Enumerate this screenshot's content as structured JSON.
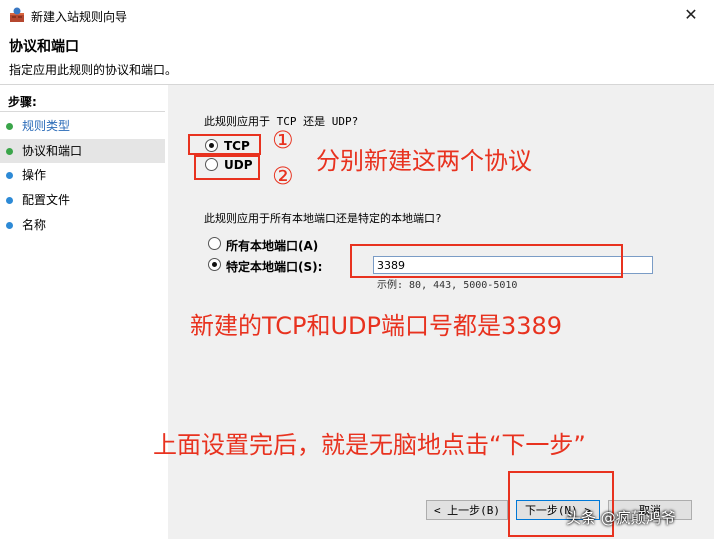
{
  "window": {
    "title": "新建入站规则向导",
    "close_glyph": "✕"
  },
  "header": {
    "title": "协议和端口",
    "description": "指定应用此规则的协议和端口。"
  },
  "sidebar": {
    "steps_label": "步骤:",
    "items": [
      {
        "label": "规则类型"
      },
      {
        "label": "协议和端口"
      },
      {
        "label": "操作"
      },
      {
        "label": "配置文件"
      },
      {
        "label": "名称"
      }
    ]
  },
  "content": {
    "protocol_question": "此规则应用于 TCP 还是 UDP?",
    "protocol_options": [
      {
        "label": "TCP",
        "selected": true
      },
      {
        "label": "UDP",
        "selected": false
      }
    ],
    "ports_question": "此规则应用于所有本地端口还是特定的本地端口?",
    "port_options": [
      {
        "label": "所有本地端口(A)",
        "selected": false
      },
      {
        "label": "特定本地端口(S):",
        "selected": true
      }
    ],
    "ports_value": "3389",
    "ports_example": "示例: 80, 443, 5000-5010"
  },
  "buttons": {
    "back": "< 上一步(B)",
    "next": "下一步(N) >",
    "cancel": "取消"
  },
  "annotations": {
    "circle_1": "①",
    "circle_2": "②",
    "note_protocols": "分别新建这两个协议",
    "note_port": "新建的TCP和UDP端口号都是3389",
    "note_next": "上面设置完后，就是无脑地点击“下一步”",
    "color": "#e8321f"
  },
  "watermark": "头条 @疯颠鸿爷"
}
